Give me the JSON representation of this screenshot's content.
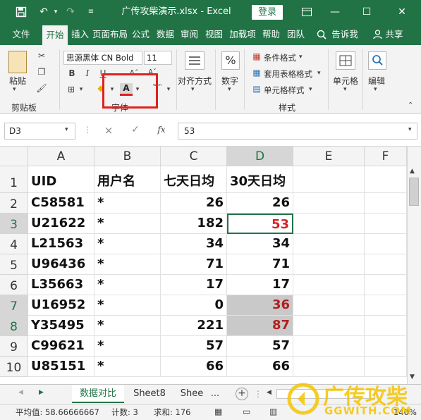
{
  "window": {
    "title": "广传攻柴演示.xlsx  -  Excel",
    "login_label": "登录",
    "accent": "#217346"
  },
  "tabs": [
    {
      "label": "文件"
    },
    {
      "label": "开始"
    },
    {
      "label": "插入"
    },
    {
      "label": "页面布局"
    },
    {
      "label": "公式"
    },
    {
      "label": "数据"
    },
    {
      "label": "审阅"
    },
    {
      "label": "视图"
    },
    {
      "label": "加载项"
    },
    {
      "label": "帮助"
    },
    {
      "label": "团队"
    }
  ],
  "tell_me": "告诉我",
  "share": "共享",
  "ribbon": {
    "paste": "粘贴",
    "clipboard_group": "剪贴板",
    "font_name": "思源黑体 CN Bold",
    "font_size": "11",
    "font_group": "字体",
    "bold": "B",
    "italic": "I",
    "underline": "U",
    "font_color_letter": "A",
    "alignment": "对齐方式",
    "number": "数字",
    "percent": "%",
    "conditional_format": "条件格式",
    "table_format": "套用表格格式",
    "cell_styles": "单元格样式",
    "styles_group": "样式",
    "cells": "单元格",
    "editing": "编辑"
  },
  "formula_bar": {
    "name_box": "D3",
    "cancel": "×",
    "enter": "✓",
    "fx": "fx",
    "value": "53"
  },
  "grid": {
    "columns": [
      "A",
      "B",
      "C",
      "D",
      "E",
      "F"
    ],
    "rows": [
      "1",
      "2",
      "3",
      "4",
      "5",
      "6",
      "7",
      "8",
      "9",
      "10"
    ],
    "header": [
      "UID",
      "用户名",
      "七天日均",
      "30天日均"
    ],
    "data": [
      [
        "C58581",
        "*",
        "26",
        "26"
      ],
      [
        "U21622",
        "*",
        "182",
        "53"
      ],
      [
        "L21563",
        "*",
        "34",
        "34"
      ],
      [
        "U96436",
        "*",
        "71",
        "71"
      ],
      [
        "L35663",
        "*",
        "17",
        "17"
      ],
      [
        "U16952",
        "*",
        "0",
        "36"
      ],
      [
        "Y35495",
        "*",
        "221",
        "87"
      ],
      [
        "C99621",
        "*",
        "57",
        "57"
      ],
      [
        "U85151",
        "*",
        "66",
        "66"
      ]
    ]
  },
  "sheets": [
    {
      "label": "数据对比"
    },
    {
      "label": "Sheet8"
    },
    {
      "label": "Shee"
    }
  ],
  "sheet_more": "...",
  "status": {
    "average": "平均值: 58.66666667",
    "count": "计数: 3",
    "sum": "求和: 176",
    "zoom": "140%"
  },
  "watermark": {
    "line1": "广传攻柴",
    "line2": "GGWITH.COM"
  }
}
